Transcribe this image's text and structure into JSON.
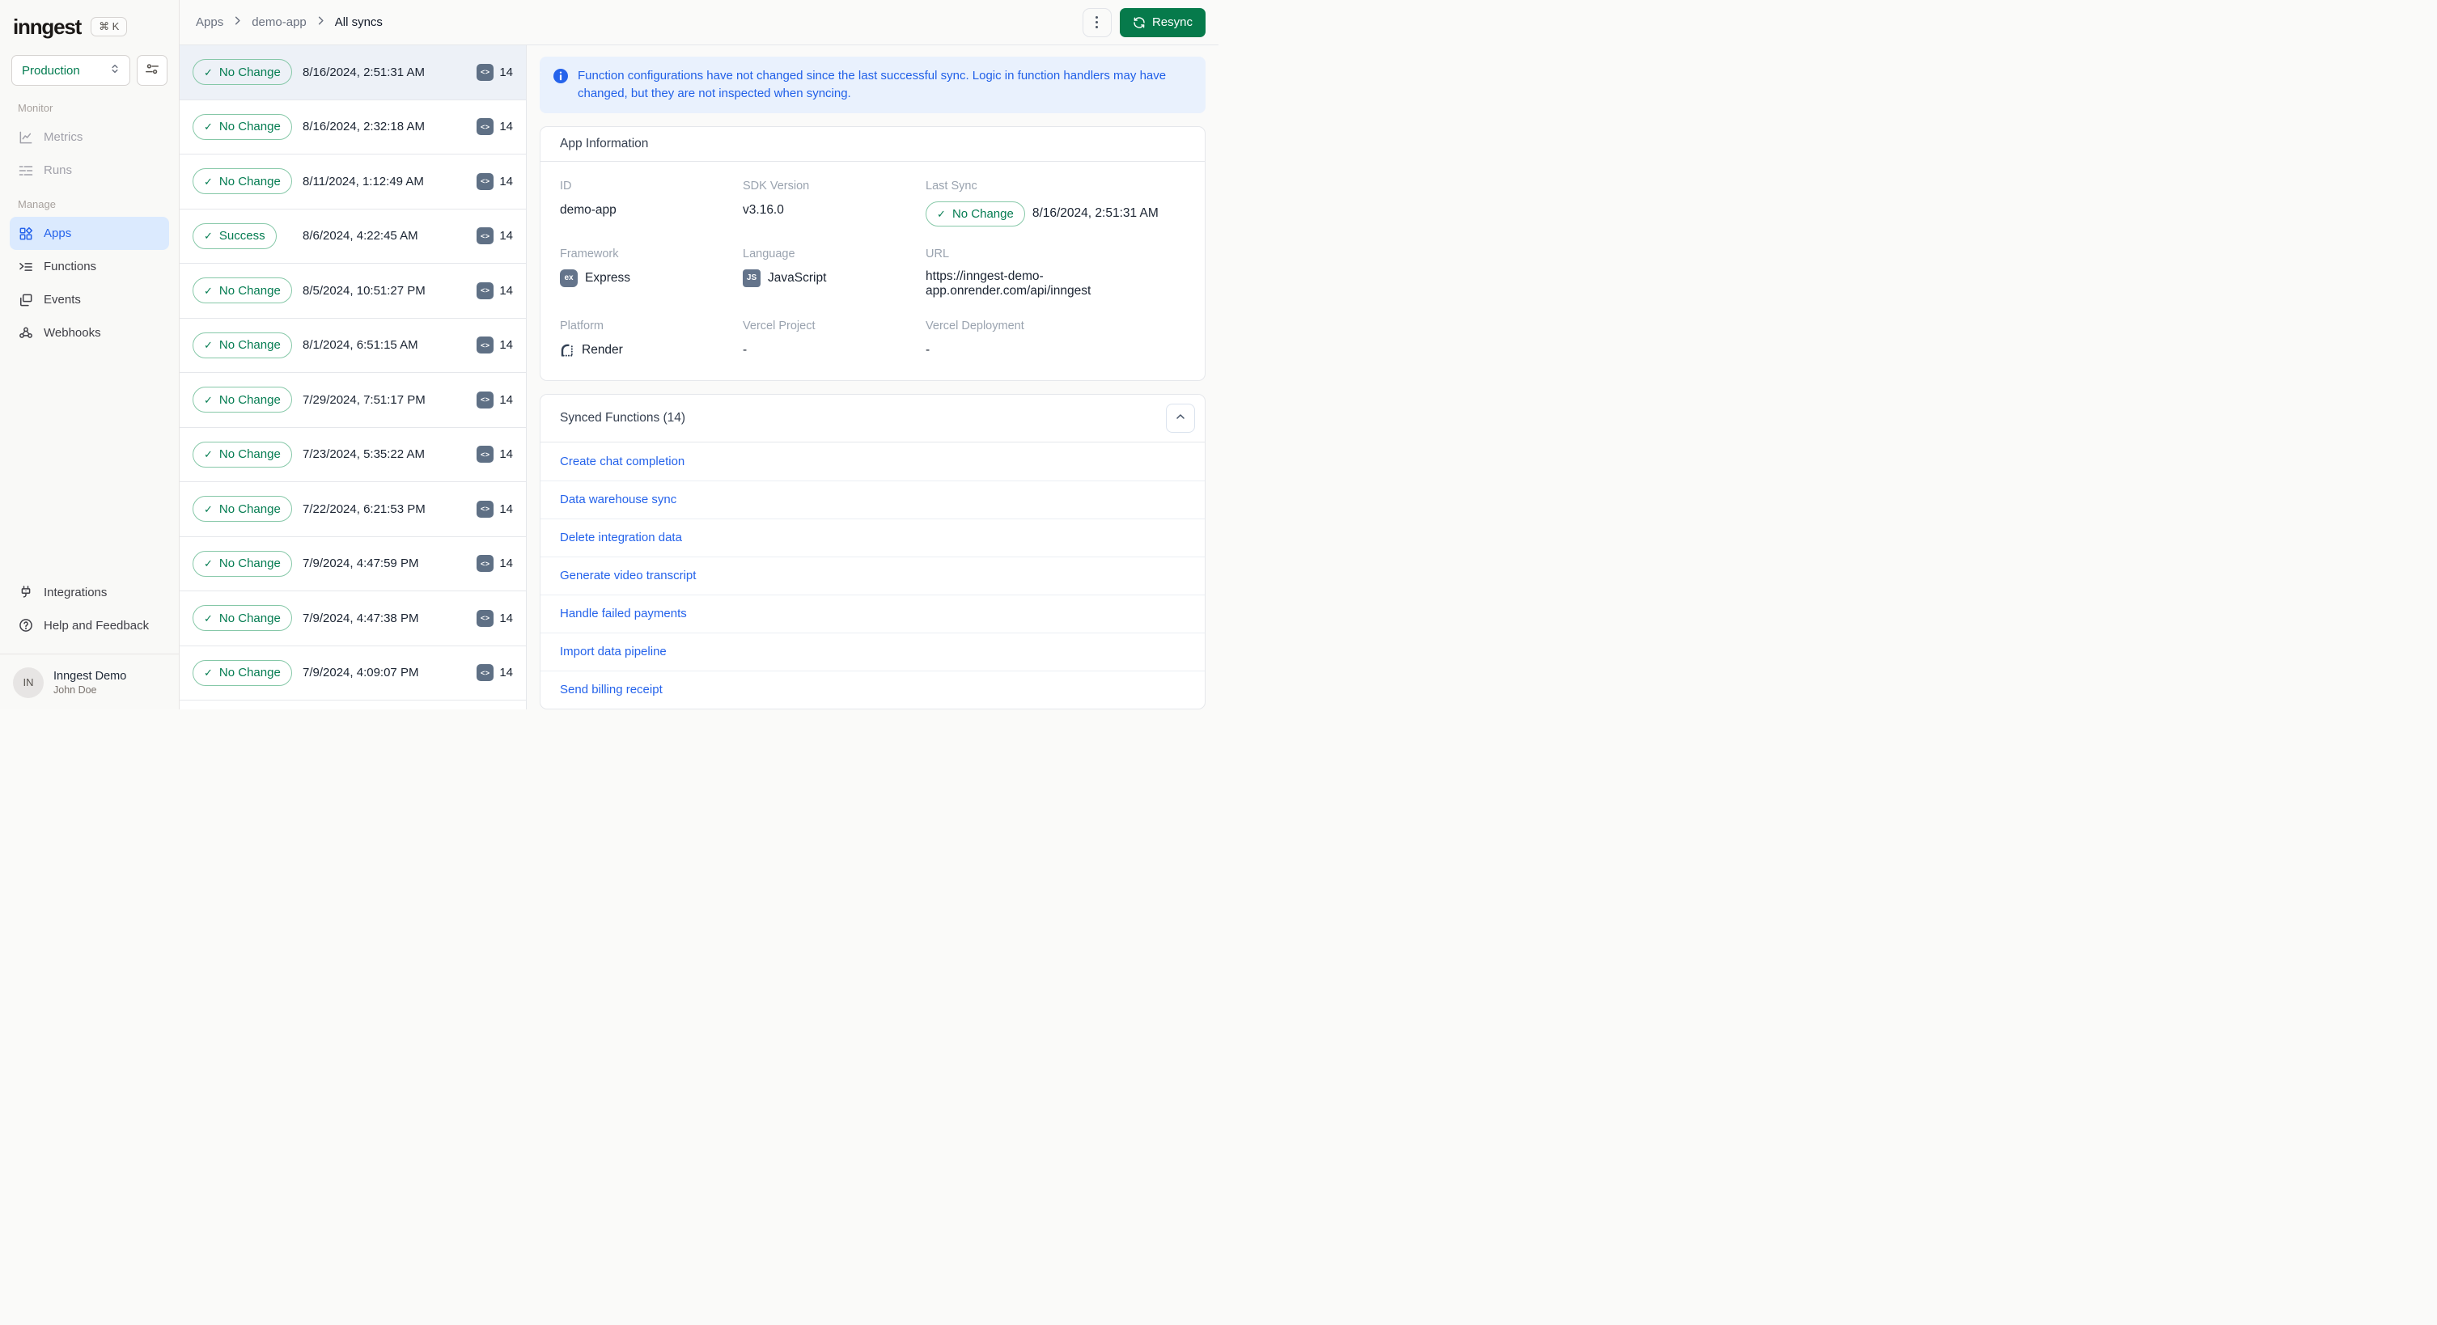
{
  "brand": {
    "logo": "inngest",
    "shortcut": "⌘ K"
  },
  "env_selector": {
    "value": "Production"
  },
  "icons": {
    "check": "✓",
    "code": "<>",
    "help": "?",
    "express": "ex",
    "javascript": "JS",
    "info": "i"
  },
  "colors": {
    "accent_green": "#067a4b",
    "badge_green": "#047c51",
    "link_blue": "#2563eb",
    "active_nav_bg": "#dbeafe",
    "banner_bg": "#e9f1fd",
    "banner_text": "#2160e8",
    "selected_row_bg": "#edf1f7"
  },
  "sidebar": {
    "sections": [
      {
        "label": "Monitor",
        "items": [
          {
            "label": "Metrics"
          },
          {
            "label": "Runs"
          }
        ]
      },
      {
        "label": "Manage",
        "items": [
          {
            "label": "Apps"
          },
          {
            "label": "Functions"
          },
          {
            "label": "Events"
          },
          {
            "label": "Webhooks"
          }
        ]
      }
    ],
    "footer_items": [
      {
        "label": "Integrations"
      },
      {
        "label": "Help and Feedback"
      }
    ],
    "user": {
      "initials": "IN",
      "org": "Inngest Demo",
      "name": "John Doe"
    }
  },
  "topbar": {
    "breadcrumb": [
      "Apps",
      "demo-app",
      "All syncs"
    ],
    "resync_label": "Resync"
  },
  "sync_list": [
    {
      "status": "No Change",
      "timestamp": "8/16/2024, 2:51:31 AM",
      "count": 14,
      "selected": true
    },
    {
      "status": "No Change",
      "timestamp": "8/16/2024, 2:32:18 AM",
      "count": 14
    },
    {
      "status": "No Change",
      "timestamp": "8/11/2024, 1:12:49 AM",
      "count": 14
    },
    {
      "status": "Success",
      "timestamp": "8/6/2024, 4:22:45 AM",
      "count": 14
    },
    {
      "status": "No Change",
      "timestamp": "8/5/2024, 10:51:27 PM",
      "count": 14
    },
    {
      "status": "No Change",
      "timestamp": "8/1/2024, 6:51:15 AM",
      "count": 14
    },
    {
      "status": "No Change",
      "timestamp": "7/29/2024, 7:51:17 PM",
      "count": 14
    },
    {
      "status": "No Change",
      "timestamp": "7/23/2024, 5:35:22 AM",
      "count": 14
    },
    {
      "status": "No Change",
      "timestamp": "7/22/2024, 6:21:53 PM",
      "count": 14
    },
    {
      "status": "No Change",
      "timestamp": "7/9/2024, 4:47:59 PM",
      "count": 14
    },
    {
      "status": "No Change",
      "timestamp": "7/9/2024, 4:47:38 PM",
      "count": 14
    },
    {
      "status": "No Change",
      "timestamp": "7/9/2024, 4:09:07 PM",
      "count": 14
    }
  ],
  "banner": {
    "text": "Function configurations have not changed since the last successful sync. Logic in function handlers may have changed, but they are not inspected when syncing."
  },
  "app_info": {
    "title": "App Information",
    "fields": [
      {
        "label": "ID",
        "value": "demo-app"
      },
      {
        "label": "SDK Version",
        "value": "v3.16.0"
      },
      {
        "label": "Last Sync",
        "badge": "No Change",
        "value": "8/16/2024, 2:51:31 AM"
      },
      {
        "label": "Framework",
        "chip": "ex",
        "value": "Express"
      },
      {
        "label": "Language",
        "chip": "JS",
        "value": "JavaScript"
      },
      {
        "label": "URL",
        "value": "https://inngest-demo-app.onrender.com/api/inngest"
      },
      {
        "label": "Platform",
        "render_icon": true,
        "value": "Render"
      },
      {
        "label": "Vercel Project",
        "value": "-"
      },
      {
        "label": "Vercel Deployment",
        "value": "-"
      }
    ]
  },
  "synced_functions": {
    "title": "Synced Functions (14)",
    "functions": [
      "Create chat completion",
      "Data warehouse sync",
      "Delete integration data",
      "Generate video transcript",
      "Handle failed payments",
      "Import data pipeline",
      "Send billing receipt"
    ]
  }
}
